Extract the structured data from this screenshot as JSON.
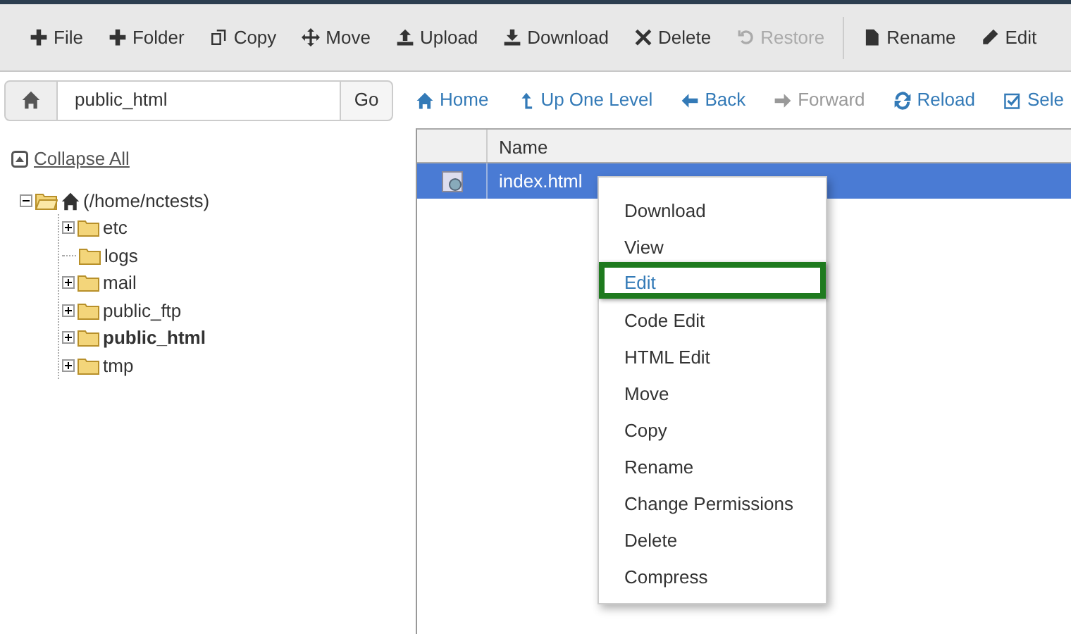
{
  "toolbar": [
    {
      "label": "File",
      "disabled": false
    },
    {
      "label": "Folder",
      "disabled": false
    },
    {
      "label": "Copy",
      "disabled": false
    },
    {
      "label": "Move",
      "disabled": false
    },
    {
      "label": "Upload",
      "disabled": false
    },
    {
      "label": "Download",
      "disabled": false
    },
    {
      "label": "Delete",
      "disabled": false
    },
    {
      "label": "Restore",
      "disabled": true
    },
    {
      "label": "Rename",
      "disabled": false
    },
    {
      "label": "Edit",
      "disabled": false
    }
  ],
  "path": {
    "value": "public_html",
    "go": "Go"
  },
  "nav": [
    {
      "label": "Home",
      "disabled": false
    },
    {
      "label": "Up One Level",
      "disabled": false
    },
    {
      "label": "Back",
      "disabled": false
    },
    {
      "label": "Forward",
      "disabled": true
    },
    {
      "label": "Reload",
      "disabled": false
    },
    {
      "label": "Sele",
      "disabled": false
    }
  ],
  "collapse_all": "Collapse All",
  "tree": [
    {
      "label": "(/home/nctests)",
      "kind": "branch",
      "expanded": true,
      "selected": false,
      "children": [
        {
          "label": "etc",
          "kind": "branch",
          "expanded": false,
          "selected": false
        },
        {
          "label": "logs",
          "kind": "leaf",
          "selected": false
        },
        {
          "label": "mail",
          "kind": "branch",
          "expanded": false,
          "selected": false
        },
        {
          "label": "public_ftp",
          "kind": "branch",
          "expanded": false,
          "selected": false
        },
        {
          "label": "public_html",
          "kind": "branch",
          "expanded": false,
          "selected": true
        },
        {
          "label": "tmp",
          "kind": "branch",
          "expanded": false,
          "selected": false
        }
      ]
    }
  ],
  "table": {
    "columns": [
      "Name"
    ],
    "rows": [
      {
        "name": "index.html",
        "selected": true
      }
    ]
  },
  "context_menu": [
    {
      "label": "Download",
      "highlighted": false
    },
    {
      "label": "View",
      "highlighted": false
    },
    {
      "label": "Edit",
      "highlighted": true
    },
    {
      "label": "Code Edit",
      "highlighted": false
    },
    {
      "label": "HTML Edit",
      "highlighted": false
    },
    {
      "label": "Move",
      "highlighted": false
    },
    {
      "label": "Copy",
      "highlighted": false
    },
    {
      "label": "Rename",
      "highlighted": false
    },
    {
      "label": "Change Permissions",
      "highlighted": false
    },
    {
      "label": "Delete",
      "highlighted": false
    },
    {
      "label": "Compress",
      "highlighted": false
    }
  ]
}
